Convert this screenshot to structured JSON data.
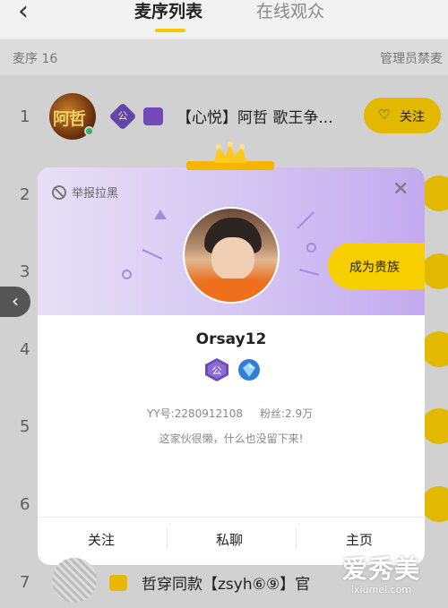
{
  "header": {
    "back_icon": "chevron-left-icon",
    "tabs": [
      {
        "label": "麦序列表",
        "active": true
      },
      {
        "label": "在线观众",
        "active": false
      }
    ]
  },
  "subbar": {
    "left": "麦序 16",
    "right": "管理员禁麦"
  },
  "list": {
    "row_numbers": [
      "1",
      "2",
      "3",
      "4",
      "5",
      "6",
      "7"
    ],
    "row1": {
      "name": "【心悦】阿哲 歌王争...",
      "avatar_text": "阿哲",
      "badge": "公",
      "follow_label": "关注"
    },
    "row7": {
      "name": "哲穿同款【zsyh⑥⑨】官"
    }
  },
  "card": {
    "report_label": "举报拉黑",
    "vip_label": "成为贵族",
    "username": "Orsay12",
    "badge_text": "公",
    "yy_label": "YY号:2280912108",
    "fans_label": "粉丝:2.9万",
    "bio": "这家伙很懒，什么也没留下来!",
    "actions": [
      "关注",
      "私聊",
      "主页"
    ],
    "colors": {
      "accent_yellow": "#f6c800",
      "header_purple": "#c3aaf0"
    }
  },
  "watermark": {
    "main": "爱秀美",
    "sub": "ixiumei.com"
  }
}
